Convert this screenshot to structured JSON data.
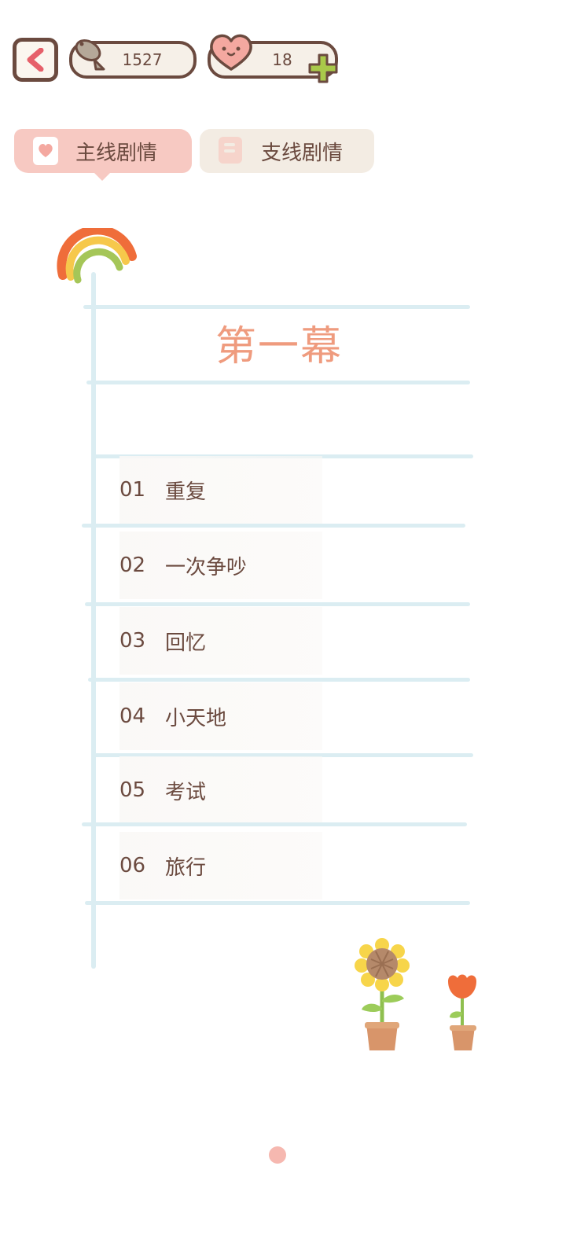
{
  "topbar": {
    "fish_count": "1527",
    "heart_count": "18"
  },
  "tabs": [
    {
      "label": "主线剧情",
      "active": true
    },
    {
      "label": "支线剧情",
      "active": false
    }
  ],
  "act": {
    "title": "第一幕"
  },
  "chapters": [
    {
      "num": "01",
      "title": "重复"
    },
    {
      "num": "02",
      "title": "一次争吵"
    },
    {
      "num": "03",
      "title": "回忆"
    },
    {
      "num": "04",
      "title": "小天地"
    },
    {
      "num": "05",
      "title": "考试"
    },
    {
      "num": "06",
      "title": "旅行"
    }
  ],
  "colors": {
    "accent": "#ef9b7e",
    "outline": "#6b4a3f",
    "line": "#dbedf2",
    "tab_active": "#f7c9c2",
    "tab_inactive": "#f3ece3"
  }
}
